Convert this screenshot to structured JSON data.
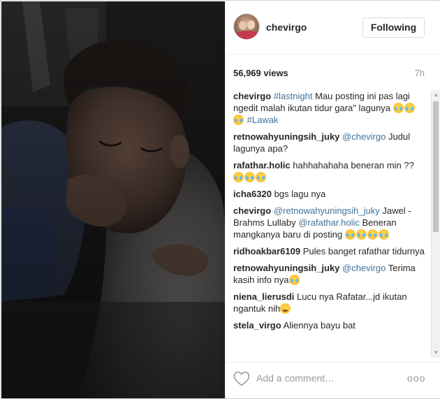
{
  "post": {
    "username": "chevirgo",
    "follow_label": "Following",
    "views": "56,969 views",
    "time": "7h"
  },
  "comments": [
    {
      "user": "chevirgo",
      "parts": [
        {
          "t": "link",
          "v": "#lastnight"
        },
        {
          "t": "text",
          "v": " Mau posting ini pas lagi ngedit malah ikutan tidur gara\" lagunya "
        },
        {
          "t": "emoji",
          "v": "crying-laughing"
        },
        {
          "t": "emoji",
          "v": "crying-laughing"
        },
        {
          "t": "emoji",
          "v": "crying-laughing"
        },
        {
          "t": "text",
          "v": " "
        },
        {
          "t": "link",
          "v": "#Lawak"
        }
      ]
    },
    {
      "user": "retnowahyuningsih_juky",
      "parts": [
        {
          "t": "link",
          "v": "@chevirgo"
        },
        {
          "t": "text",
          "v": " Judul lagunya apa?"
        }
      ]
    },
    {
      "user": "rafathar.holic",
      "parts": [
        {
          "t": "text",
          "v": " hahhahahaha beneran min ?? "
        },
        {
          "t": "emoji",
          "v": "crying-laughing"
        },
        {
          "t": "emoji",
          "v": "crying-laughing"
        },
        {
          "t": "emoji",
          "v": "crying-laughing"
        }
      ]
    },
    {
      "user": "icha6320",
      "parts": [
        {
          "t": "text",
          "v": " bgs lagu nya"
        }
      ]
    },
    {
      "user": "chevirgo",
      "parts": [
        {
          "t": "link",
          "v": "@retnowahyuningsih_juky"
        },
        {
          "t": "text",
          "v": " Jawel - Brahms Lullaby "
        },
        {
          "t": "link",
          "v": "@rafathar.holic"
        },
        {
          "t": "text",
          "v": " Beneran mangkanya baru di posting "
        },
        {
          "t": "emoji",
          "v": "crying-laughing"
        },
        {
          "t": "emoji",
          "v": "crying-laughing"
        },
        {
          "t": "emoji",
          "v": "crying-laughing"
        },
        {
          "t": "emoji",
          "v": "crying-laughing"
        }
      ]
    },
    {
      "user": "ridhoakbar6109",
      "parts": [
        {
          "t": "text",
          "v": " Pules banget rafathar tidurnya"
        }
      ]
    },
    {
      "user": "retnowahyuningsih_juky",
      "parts": [
        {
          "t": "link",
          "v": "@chevirgo"
        },
        {
          "t": "text",
          "v": " Terima kasih info nya"
        },
        {
          "t": "emoji",
          "v": "grinning"
        }
      ]
    },
    {
      "user": "niena_lierusdi",
      "parts": [
        {
          "t": "text",
          "v": " Lucu nya Rafatar...jd ikutan ngantuk nih"
        },
        {
          "t": "emoji",
          "v": "sleepy"
        }
      ]
    },
    {
      "user": "stela_virgo",
      "parts": [
        {
          "t": "text",
          "v": " Aliennya bayu bat"
        }
      ]
    }
  ],
  "footer": {
    "comment_placeholder": "Add a comment…",
    "more_label": "ooo"
  },
  "icons": {
    "heart": "heart-outline-icon",
    "more": "more-options-icon",
    "scroll_up": "scroll-up-arrow-icon",
    "scroll_down": "scroll-down-arrow-icon"
  },
  "colors": {
    "link": "#3f729b",
    "text": "#262626",
    "muted": "#999999"
  }
}
